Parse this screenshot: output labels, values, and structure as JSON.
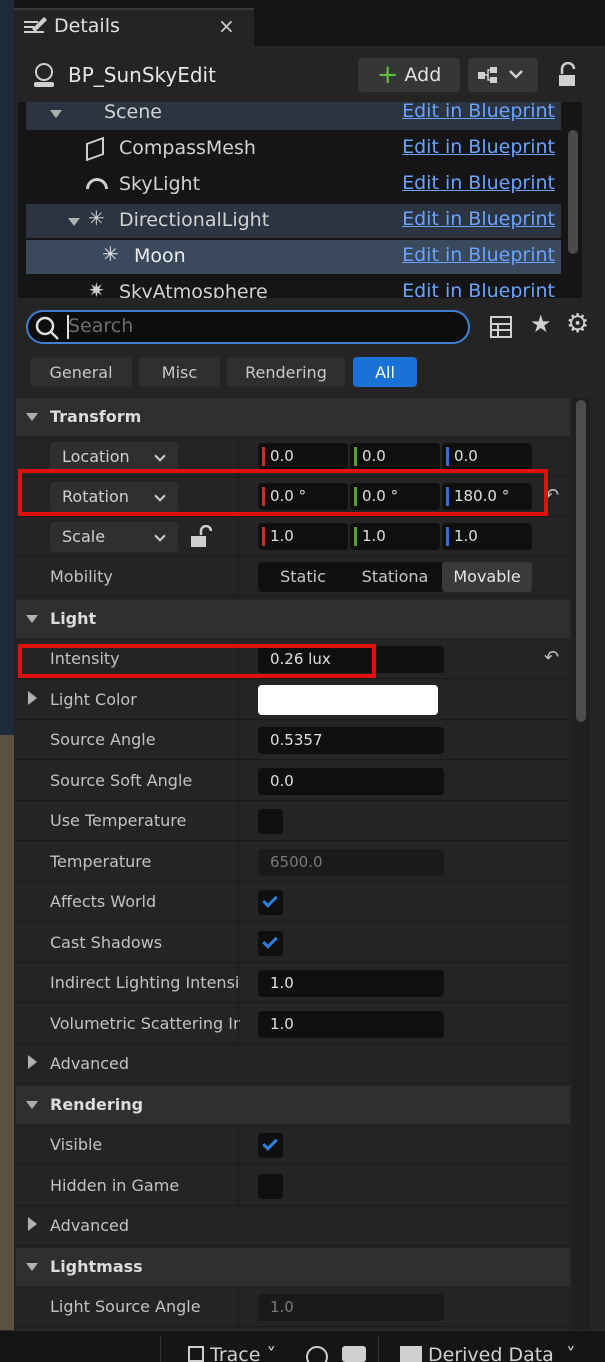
{
  "tab": {
    "title": "Details",
    "close": "×"
  },
  "header": {
    "actor_name": "BP_SunSkyEdit",
    "add_label": "Add"
  },
  "components": [
    {
      "label": "Scene",
      "edit": "Edit in Blueprint"
    },
    {
      "label": "CompassMesh",
      "edit": "Edit in Blueprint"
    },
    {
      "label": "SkyLight",
      "edit": "Edit in Blueprint"
    },
    {
      "label": "DirectionalLight",
      "edit": "Edit in Blueprint"
    },
    {
      "label": "Moon",
      "edit": "Edit in Blueprint"
    },
    {
      "label": "SkyAtmosphere",
      "edit": "Edit in Blueprint"
    }
  ],
  "search": {
    "placeholder": "Search"
  },
  "filters": [
    "General",
    "Misc",
    "Rendering",
    "All"
  ],
  "transform": {
    "section": "Transform",
    "location": {
      "label": "Location",
      "x": "0.0",
      "y": "0.0",
      "z": "0.0"
    },
    "rotation": {
      "label": "Rotation",
      "x": "0.0 °",
      "y": "0.0 °",
      "z": "180.0 °"
    },
    "scale": {
      "label": "Scale",
      "x": "1.0",
      "y": "1.0",
      "z": "1.0"
    },
    "mobility": {
      "label": "Mobility",
      "options": [
        "Static",
        "Stationa",
        "Movable"
      ],
      "selected": "Movable"
    }
  },
  "light": {
    "section": "Light",
    "intensity": {
      "label": "Intensity",
      "value": "0.26 lux"
    },
    "light_color": {
      "label": "Light Color",
      "color": "#ffffff"
    },
    "source_angle": {
      "label": "Source Angle",
      "value": "0.5357"
    },
    "source_soft_angle": {
      "label": "Source Soft Angle",
      "value": "0.0"
    },
    "use_temperature": {
      "label": "Use Temperature",
      "checked": false
    },
    "temperature": {
      "label": "Temperature",
      "value": "6500.0"
    },
    "affects_world": {
      "label": "Affects World",
      "checked": true
    },
    "cast_shadows": {
      "label": "Cast Shadows",
      "checked": true
    },
    "indirect": {
      "label": "Indirect Lighting Intensity",
      "value": "1.0"
    },
    "volumetric": {
      "label": "Volumetric Scattering In...",
      "value": "1.0"
    },
    "advanced": "Advanced"
  },
  "rendering": {
    "section": "Rendering",
    "visible": {
      "label": "Visible",
      "checked": true
    },
    "hidden_in_game": {
      "label": "Hidden in Game",
      "checked": false
    },
    "advanced": "Advanced"
  },
  "lightmass": {
    "section": "Lightmass",
    "light_source_angle": {
      "label": "Light Source Angle",
      "value": "1.0"
    }
  },
  "statusbar": {
    "trace": "Trace",
    "derived": "Derived Data"
  },
  "colors": {
    "accent": "#1a71d6",
    "highlight": "#e01010",
    "link": "#6aa3ff",
    "x_axis": "#c8321e",
    "y_axis": "#5aa02c",
    "z_axis": "#2f6fd6"
  }
}
